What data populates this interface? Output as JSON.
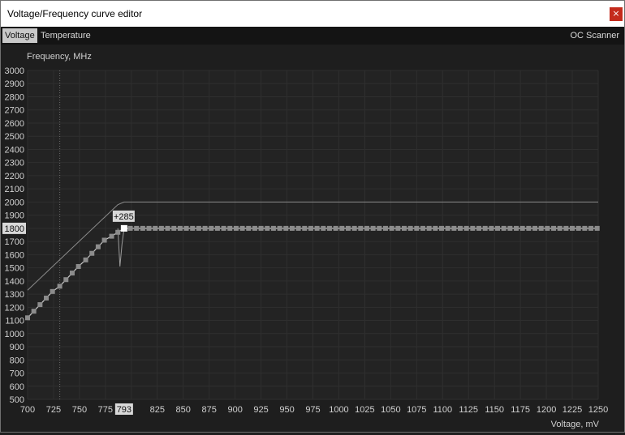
{
  "window": {
    "title": "Voltage/Frequency curve editor",
    "close_glyph": "×"
  },
  "tabs": [
    {
      "label": "Voltage",
      "active": true
    },
    {
      "label": "Temperature",
      "active": false
    }
  ],
  "oc_scanner_label": "OC Scanner",
  "chart_data": {
    "type": "line",
    "ylabel": "Frequency, MHz",
    "xlabel": "Voltage, mV",
    "xlim": [
      700,
      1250
    ],
    "ylim": [
      500,
      3000
    ],
    "x_ticks": [
      700,
      725,
      750,
      775,
      800,
      825,
      850,
      875,
      900,
      925,
      950,
      975,
      1000,
      1025,
      1050,
      1075,
      1100,
      1125,
      1150,
      1175,
      1200,
      1225,
      1250
    ],
    "x_tick_labels": [
      "700",
      "725",
      "750",
      "775",
      "793",
      "825",
      "850",
      "875",
      "900",
      "925",
      "950",
      "975",
      "1000",
      "1025",
      "1050",
      "1075",
      "1100",
      "1125",
      "1150",
      "1175",
      "1200",
      "1225",
      "1250"
    ],
    "y_ticks": [
      500,
      600,
      700,
      800,
      900,
      1000,
      1100,
      1200,
      1300,
      1400,
      1500,
      1600,
      1700,
      1800,
      1900,
      2000,
      2100,
      2200,
      2300,
      2400,
      2500,
      2600,
      2700,
      2800,
      2900,
      3000
    ],
    "y_tick_labels": [
      "500",
      "600",
      "700",
      "800",
      "900",
      "1000",
      "1100",
      "1200",
      "1300",
      "1400",
      "1500",
      "1600",
      "1700",
      "1800",
      "1900",
      "2000",
      "2100",
      "2200",
      "2300",
      "2400",
      "2500",
      "2600",
      "2700",
      "2800",
      "2900",
      "3000"
    ],
    "highlight": {
      "x_label": "793",
      "y_label": "1800",
      "x": 793,
      "y": 1800
    },
    "offset_label": "+285",
    "marker_line_x": 731,
    "series": [
      {
        "role": "curve-points",
        "x": [
          700,
          706,
          712,
          718,
          724,
          731,
          737,
          743,
          749,
          756,
          762,
          768,
          774,
          781,
          787,
          793
        ],
        "y": [
          1120,
          1170,
          1220,
          1270,
          1320,
          1360,
          1410,
          1460,
          1510,
          1560,
          1610,
          1660,
          1710,
          1740,
          1770,
          1800
        ],
        "flat_until": 1250
      },
      {
        "role": "upper-curve",
        "x": [
          700,
          787,
          793,
          1250
        ],
        "y": [
          1330,
          1980,
          2000,
          2000
        ]
      },
      {
        "role": "default-curve",
        "x": [
          787,
          789,
          791,
          793,
          796
        ],
        "y": [
          1800,
          1510,
          1680,
          1800,
          1800
        ]
      }
    ],
    "grid": true
  }
}
